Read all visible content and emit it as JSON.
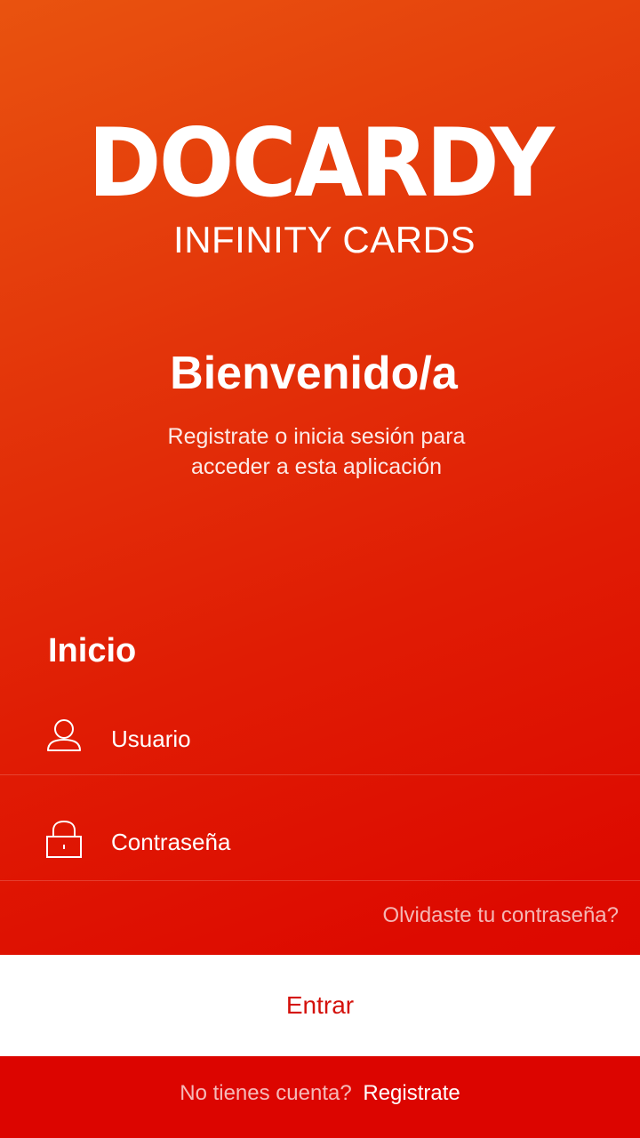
{
  "brand": {
    "name": "DOCARDY",
    "tagline": "INFINITY CARDS"
  },
  "welcome": {
    "title": "Bienvenido/a",
    "subtitle": "Registrate o inicia sesión para acceder a esta aplicación"
  },
  "login": {
    "section_title": "Inicio",
    "username": {
      "placeholder": "Usuario",
      "value": "",
      "icon": "user-icon"
    },
    "password": {
      "placeholder": "Contraseña",
      "value": "",
      "icon": "lock-icon"
    },
    "forgot_label": "Olvidaste tu contraseña?",
    "submit_label": "Entrar"
  },
  "footer": {
    "question": "No tienes cuenta?",
    "register_label": "Registrate"
  },
  "colors": {
    "gradient_top": "#e9530f",
    "gradient_bottom": "#dc0500",
    "button_background": "#ffffff",
    "button_text": "#d4110b"
  }
}
